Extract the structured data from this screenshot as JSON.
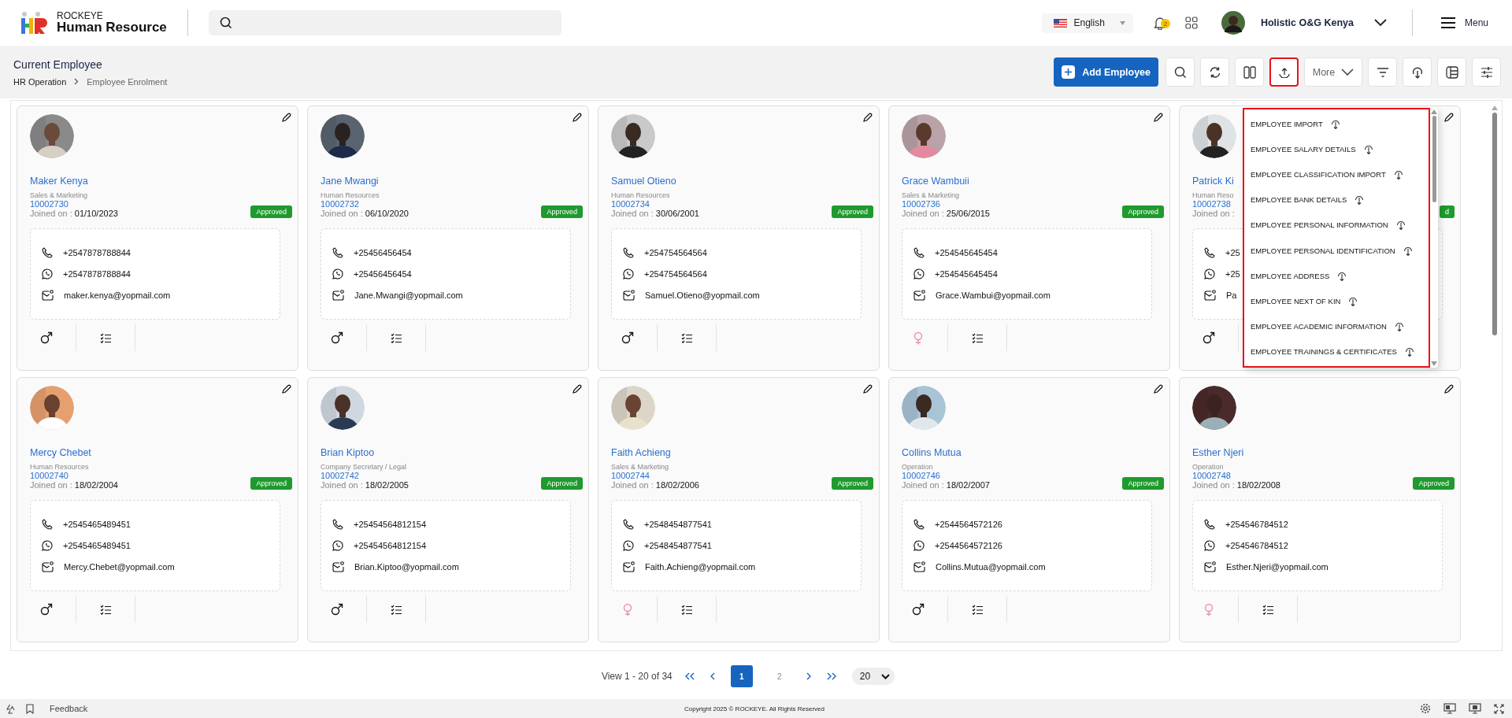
{
  "header": {
    "brand_small": "ROCKEYE",
    "brand": "Human Resource",
    "language": "English",
    "notifications": "2",
    "user": "Holistic O&G Kenya",
    "menu": "Menu"
  },
  "page": {
    "title": "Current Employee",
    "breadcrumb": [
      "HR Operation",
      "Employee Enrolment"
    ]
  },
  "toolbar": {
    "add_label": "Add Employee",
    "more_label": "More",
    "tools": [
      {
        "kind": "search",
        "selected": false
      },
      {
        "kind": "refresh",
        "selected": false
      },
      {
        "kind": "columns",
        "selected": false
      },
      {
        "kind": "upload",
        "selected": true
      },
      {
        "kind": "more",
        "selected": false
      },
      {
        "kind": "filter",
        "selected": false
      },
      {
        "kind": "download",
        "selected": false
      },
      {
        "kind": "layout",
        "selected": false
      },
      {
        "kind": "sliders",
        "selected": false
      }
    ]
  },
  "cards": [
    {
      "name": "Maker Kenya",
      "department": "Sales & Marketing",
      "id": "10002730",
      "joined_label": "Joined on :",
      "joined": "01/10/2023",
      "status": "Approved",
      "phone": "+2547878788844",
      "whatsapp": "+2547878788844",
      "email": "maker.kenya@yopmail.com",
      "female": false
    },
    {
      "name": "Jane Mwangi",
      "department": "Human Resources",
      "id": "10002732",
      "joined_label": "Joined on :",
      "joined": "06/10/2020",
      "status": "Approved",
      "phone": "+25456456454",
      "whatsapp": "+25456456454",
      "email": "Jane.Mwangi@yopmail.com",
      "female": false
    },
    {
      "name": "Samuel Otieno",
      "department": "Human Resources",
      "id": "10002734",
      "joined_label": "Joined on :",
      "joined": "30/06/2001",
      "status": "Approved",
      "phone": "+254754564564",
      "whatsapp": "+254754564564",
      "email": "Samuel.Otieno@yopmail.com",
      "female": false
    },
    {
      "name": "Grace Wambuii",
      "department": "Sales & Marketing",
      "id": "10002736",
      "joined_label": "Joined on :",
      "joined": "25/06/2015",
      "status": "Approved",
      "phone": "+254545645454",
      "whatsapp": "+254545645454",
      "email": "Grace.Wambui@yopmail.com",
      "female": true
    },
    {
      "name": "Patrick Ki",
      "department": "Human Reso",
      "id": "10002738",
      "joined_label": "Joined on :",
      "status": "d",
      "phone": "+25",
      "whatsapp": "+25",
      "email": "Pa",
      "female": false
    },
    {
      "name": "Mercy Chebet",
      "department": "Human Resources",
      "id": "10002740",
      "joined_label": "Joined on :",
      "joined": "18/02/2004",
      "status": "Approved",
      "phone": "+2545465489451",
      "whatsapp": "+2545465489451",
      "email": "Mercy.Chebet@yopmail.com",
      "female": false
    },
    {
      "name": "Brian Kiptoo",
      "department": "Company Secretary / Legal",
      "id": "10002742",
      "joined_label": "Joined on :",
      "joined": "18/02/2005",
      "status": "Approved",
      "phone": "+25454564812154",
      "whatsapp": "+25454564812154",
      "email": "Brian.Kiptoo@yopmail.com",
      "female": false
    },
    {
      "name": "Faith Achieng",
      "department": "Sales & Marketing",
      "id": "10002744",
      "joined_label": "Joined on :",
      "joined": "18/02/2006",
      "status": "Approved",
      "phone": "+2548454877541",
      "whatsapp": "+2548454877541",
      "email": "Faith.Achieng@yopmail.com",
      "female": true
    },
    {
      "name": "Collins Mutua",
      "department": "Operation",
      "id": "10002746",
      "joined_label": "Joined on :",
      "joined": "18/02/2007",
      "status": "Approved",
      "phone": "+2544564572126",
      "whatsapp": "+2544564572126",
      "email": "Collins.Mutua@yopmail.com",
      "female": false
    },
    {
      "name": "Esther Njeri",
      "department": "Operation",
      "id": "10002748",
      "joined_label": "Joined on :",
      "joined": "18/02/2008",
      "status": "Approved",
      "phone": "+254546784512",
      "whatsapp": "+254546784512",
      "email": "Esther.Njeri@yopmail.com",
      "female": true
    }
  ],
  "import_menu": [
    "EMPLOYEE IMPORT",
    "EMPLOYEE SALARY DETAILS",
    "EMPLOYEE CLASSIFICATION IMPORT",
    "EMPLOYEE BANK DETAILS",
    "EMPLOYEE PERSONAL INFORMATION",
    "EMPLOYEE PERSONAL IDENTIFICATION",
    "EMPLOYEE ADDRESS",
    "EMPLOYEE NEXT OF KIN",
    "EMPLOYEE ACADEMIC INFORMATION",
    "EMPLOYEE TRAININGS & CERTIFICATES"
  ],
  "pagination": {
    "summary": "View 1 - 20 of 34",
    "pages": [
      {
        "label": "1",
        "selected": true
      },
      {
        "label": "2",
        "selected": false
      }
    ],
    "page_size": "20"
  },
  "footer": {
    "feedback": "Feedback",
    "copyright": "Copyright 2025 © ROCKEYE. All Rights Reserved"
  }
}
